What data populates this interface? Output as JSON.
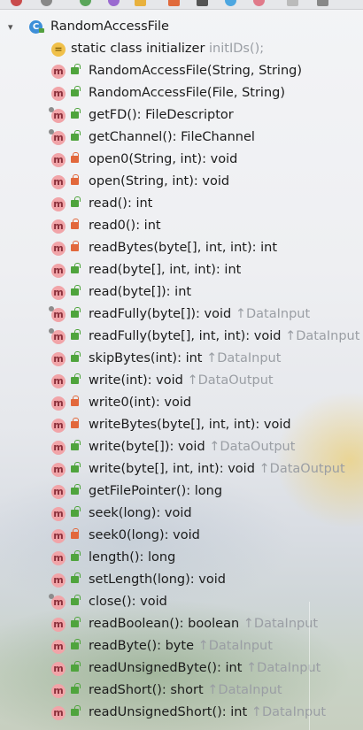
{
  "root": {
    "label": "RandomAccessFile",
    "icon": "class-icon"
  },
  "members": [
    {
      "kind": "initializer",
      "vis": "none",
      "label": "static class initializer",
      "extra": "initIDs();"
    },
    {
      "kind": "method",
      "vis": "public",
      "label": "RandomAccessFile(String, String)",
      "extra": ""
    },
    {
      "kind": "method",
      "vis": "public",
      "label": "RandomAccessFile(File, String)",
      "extra": ""
    },
    {
      "kind": "method",
      "vis": "public",
      "override": true,
      "label": "getFD(): FileDescriptor",
      "extra": ""
    },
    {
      "kind": "method",
      "vis": "public",
      "override": true,
      "label": "getChannel(): FileChannel",
      "extra": ""
    },
    {
      "kind": "method",
      "vis": "private",
      "label": "open0(String, int): void",
      "extra": ""
    },
    {
      "kind": "method",
      "vis": "private",
      "label": "open(String, int): void",
      "extra": ""
    },
    {
      "kind": "method",
      "vis": "public",
      "label": "read(): int",
      "extra": ""
    },
    {
      "kind": "method",
      "vis": "private",
      "label": "read0(): int",
      "extra": ""
    },
    {
      "kind": "method",
      "vis": "private",
      "label": "readBytes(byte[], int, int): int",
      "extra": ""
    },
    {
      "kind": "method",
      "vis": "public",
      "label": "read(byte[], int, int): int",
      "extra": ""
    },
    {
      "kind": "method",
      "vis": "public",
      "label": "read(byte[]): int",
      "extra": ""
    },
    {
      "kind": "method",
      "vis": "public",
      "override": true,
      "label": "readFully(byte[]): void",
      "extra": "↑DataInput"
    },
    {
      "kind": "method",
      "vis": "public",
      "override": true,
      "label": "readFully(byte[], int, int): void",
      "extra": "↑DataInput"
    },
    {
      "kind": "method",
      "vis": "public",
      "label": "skipBytes(int): int",
      "extra": "↑DataInput"
    },
    {
      "kind": "method",
      "vis": "public",
      "label": "write(int): void",
      "extra": "↑DataOutput"
    },
    {
      "kind": "method",
      "vis": "private",
      "label": "write0(int): void",
      "extra": ""
    },
    {
      "kind": "method",
      "vis": "private",
      "label": "writeBytes(byte[], int, int): void",
      "extra": ""
    },
    {
      "kind": "method",
      "vis": "public",
      "label": "write(byte[]): void",
      "extra": "↑DataOutput"
    },
    {
      "kind": "method",
      "vis": "public",
      "label": "write(byte[], int, int): void",
      "extra": "↑DataOutput"
    },
    {
      "kind": "method",
      "vis": "public",
      "label": "getFilePointer(): long",
      "extra": ""
    },
    {
      "kind": "method",
      "vis": "public",
      "label": "seek(long): void",
      "extra": ""
    },
    {
      "kind": "method",
      "vis": "private",
      "label": "seek0(long): void",
      "extra": ""
    },
    {
      "kind": "method",
      "vis": "public",
      "label": "length(): long",
      "extra": ""
    },
    {
      "kind": "method",
      "vis": "public",
      "label": "setLength(long): void",
      "extra": ""
    },
    {
      "kind": "method",
      "vis": "public",
      "override": true,
      "label": "close(): void",
      "extra": ""
    },
    {
      "kind": "method",
      "vis": "public",
      "label": "readBoolean(): boolean",
      "extra": "↑DataInput"
    },
    {
      "kind": "method",
      "vis": "public",
      "label": "readByte(): byte",
      "extra": "↑DataInput"
    },
    {
      "kind": "method",
      "vis": "public",
      "label": "readUnsignedByte(): int",
      "extra": "↑DataInput"
    },
    {
      "kind": "method",
      "vis": "public",
      "label": "readShort(): short",
      "extra": "↑DataInput"
    },
    {
      "kind": "method",
      "vis": "public",
      "label": "readUnsignedShort(): int",
      "extra": "↑DataInput"
    }
  ],
  "icon_letters": {
    "class": "C",
    "method": "m",
    "initializer": "="
  },
  "colors": {
    "method_icon": "#f1a4a8",
    "class_icon": "#3d8fd8",
    "public": "#4fa43d",
    "private": "#e2683c",
    "inherited_text": "#9a9ea4"
  }
}
